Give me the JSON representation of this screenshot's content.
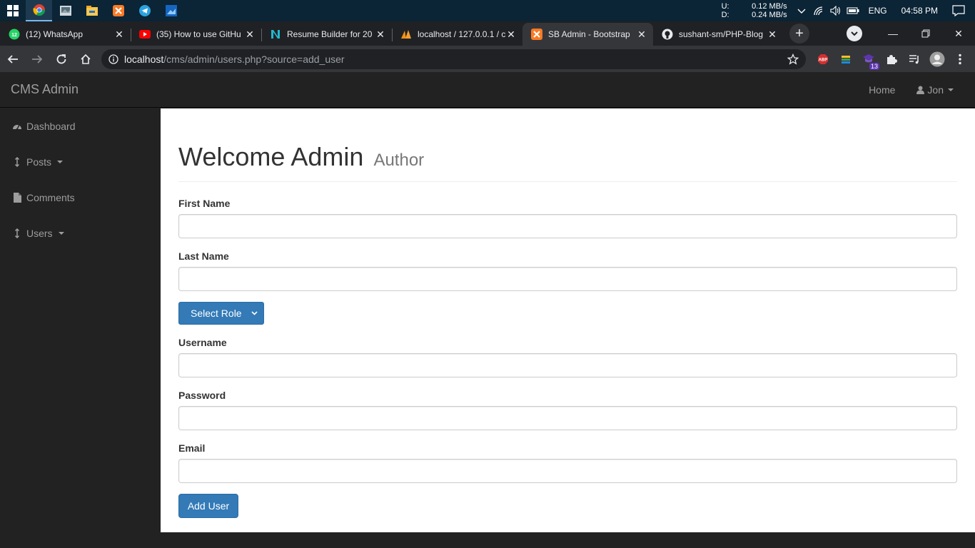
{
  "taskbar": {
    "apps": [
      {
        "name": "chrome-icon",
        "active": true
      },
      {
        "name": "photos-icon",
        "active": false
      },
      {
        "name": "file-explorer-icon",
        "active": false
      },
      {
        "name": "xampp-icon",
        "active": false
      },
      {
        "name": "telegram-icon",
        "active": false
      },
      {
        "name": "image-viewer-icon",
        "active": false
      }
    ],
    "net_up_label": "U:",
    "net_up_value": "0.12 MB/s",
    "net_down_label": "D:",
    "net_down_value": "0.24 MB/s",
    "language": "ENG",
    "time": "04:58 PM"
  },
  "browser": {
    "tabs": [
      {
        "title": "(12) WhatsApp",
        "icon": "whatsapp-icon"
      },
      {
        "title": "(35) How to use GitHu",
        "icon": "youtube-icon"
      },
      {
        "title": "Resume Builder for 20",
        "icon": "resume-icon"
      },
      {
        "title": "localhost / 127.0.0.1 / c",
        "icon": "phpmyadmin-icon"
      },
      {
        "title": "SB Admin - Bootstrap",
        "icon": "xampp-icon"
      },
      {
        "title": "sushant-sm/PHP-Blog",
        "icon": "github-icon"
      }
    ],
    "active_tab": 4,
    "url_host": "localhost",
    "url_path": "/cms/admin/users.php?source=add_user",
    "extension_badge": "13"
  },
  "navbar": {
    "brand": "CMS Admin",
    "home": "Home",
    "user": "Jon"
  },
  "sidebar": {
    "items": [
      {
        "label": "Dashboard",
        "icon": "dashboard-icon",
        "dropdown": false
      },
      {
        "label": "Posts",
        "icon": "arrows-v-icon",
        "dropdown": true
      },
      {
        "label": "Comments",
        "icon": "file-icon",
        "dropdown": false
      },
      {
        "label": "Users",
        "icon": "arrows-v-icon",
        "dropdown": true
      }
    ]
  },
  "main": {
    "title": "Welcome Admin",
    "subtitle": "Author",
    "first_name_label": "First Name",
    "last_name_label": "Last Name",
    "role_select": "Select Role",
    "username_label": "Username",
    "password_label": "Password",
    "email_label": "Email",
    "submit": "Add User"
  },
  "colors": {
    "primary": "#337ab7",
    "navbar_bg": "#222222",
    "taskbar_bg": "#0b2436"
  }
}
